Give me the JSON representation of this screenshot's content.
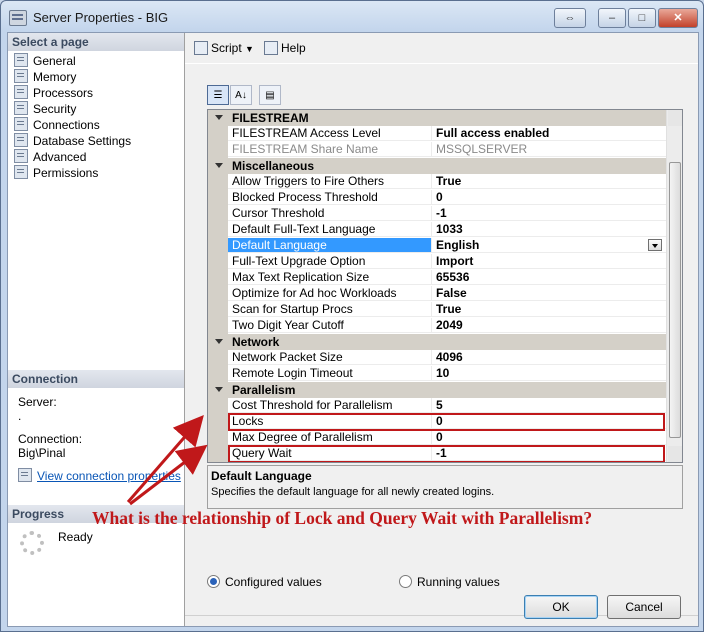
{
  "window": {
    "title": "Server Properties - BIG"
  },
  "left": {
    "select_page_header": "Select a page",
    "pages": [
      {
        "label": "General"
      },
      {
        "label": "Memory"
      },
      {
        "label": "Processors"
      },
      {
        "label": "Security"
      },
      {
        "label": "Connections"
      },
      {
        "label": "Database Settings"
      },
      {
        "label": "Advanced"
      },
      {
        "label": "Permissions"
      }
    ],
    "connection_header": "Connection",
    "server_label": "Server:",
    "server_value": ".",
    "connection_label": "Connection:",
    "connection_value": "Big\\Pinal",
    "view_link": "View connection properties",
    "progress_header": "Progress",
    "progress_status": "Ready"
  },
  "toolbar": {
    "script_label": "Script",
    "help_label": "Help"
  },
  "grid": {
    "rows": [
      {
        "type": "category",
        "name": "FILESTREAM"
      },
      {
        "type": "prop",
        "name": "FILESTREAM Access Level",
        "value": "Full access enabled"
      },
      {
        "type": "prop",
        "name": "FILESTREAM Share Name",
        "value": "MSSQLSERVER",
        "disabled": true
      },
      {
        "type": "category",
        "name": "Miscellaneous"
      },
      {
        "type": "prop",
        "name": "Allow Triggers to Fire Others",
        "value": "True"
      },
      {
        "type": "prop",
        "name": "Blocked Process Threshold",
        "value": "0"
      },
      {
        "type": "prop",
        "name": "Cursor Threshold",
        "value": "-1"
      },
      {
        "type": "prop",
        "name": "Default Full-Text Language",
        "value": "1033"
      },
      {
        "type": "prop",
        "name": "Default Language",
        "value": "English",
        "selected": true
      },
      {
        "type": "prop",
        "name": "Full-Text Upgrade Option",
        "value": "Import"
      },
      {
        "type": "prop",
        "name": "Max Text Replication Size",
        "value": "65536"
      },
      {
        "type": "prop",
        "name": "Optimize for Ad hoc Workloads",
        "value": "False"
      },
      {
        "type": "prop",
        "name": "Scan for Startup Procs",
        "value": "True"
      },
      {
        "type": "prop",
        "name": "Two Digit Year Cutoff",
        "value": "2049"
      },
      {
        "type": "category",
        "name": "Network"
      },
      {
        "type": "prop",
        "name": "Network Packet Size",
        "value": "4096"
      },
      {
        "type": "prop",
        "name": "Remote Login Timeout",
        "value": "10"
      },
      {
        "type": "category",
        "name": "Parallelism"
      },
      {
        "type": "prop",
        "name": "Cost Threshold for Parallelism",
        "value": "5"
      },
      {
        "type": "prop",
        "name": "Locks",
        "value": "0"
      },
      {
        "type": "prop",
        "name": "Max Degree of Parallelism",
        "value": "0"
      },
      {
        "type": "prop",
        "name": "Query Wait",
        "value": "-1"
      }
    ]
  },
  "description": {
    "title": "Default Language",
    "text": "Specifies the default language for all newly created logins."
  },
  "annotation": {
    "text": "What is the relationship of Lock and Query Wait with Parallelism?",
    "color": "#c0181a"
  },
  "options": {
    "configured_label": "Configured values",
    "running_label": "Running values",
    "selected": "configured"
  },
  "buttons": {
    "ok_label": "OK",
    "cancel_label": "Cancel"
  }
}
